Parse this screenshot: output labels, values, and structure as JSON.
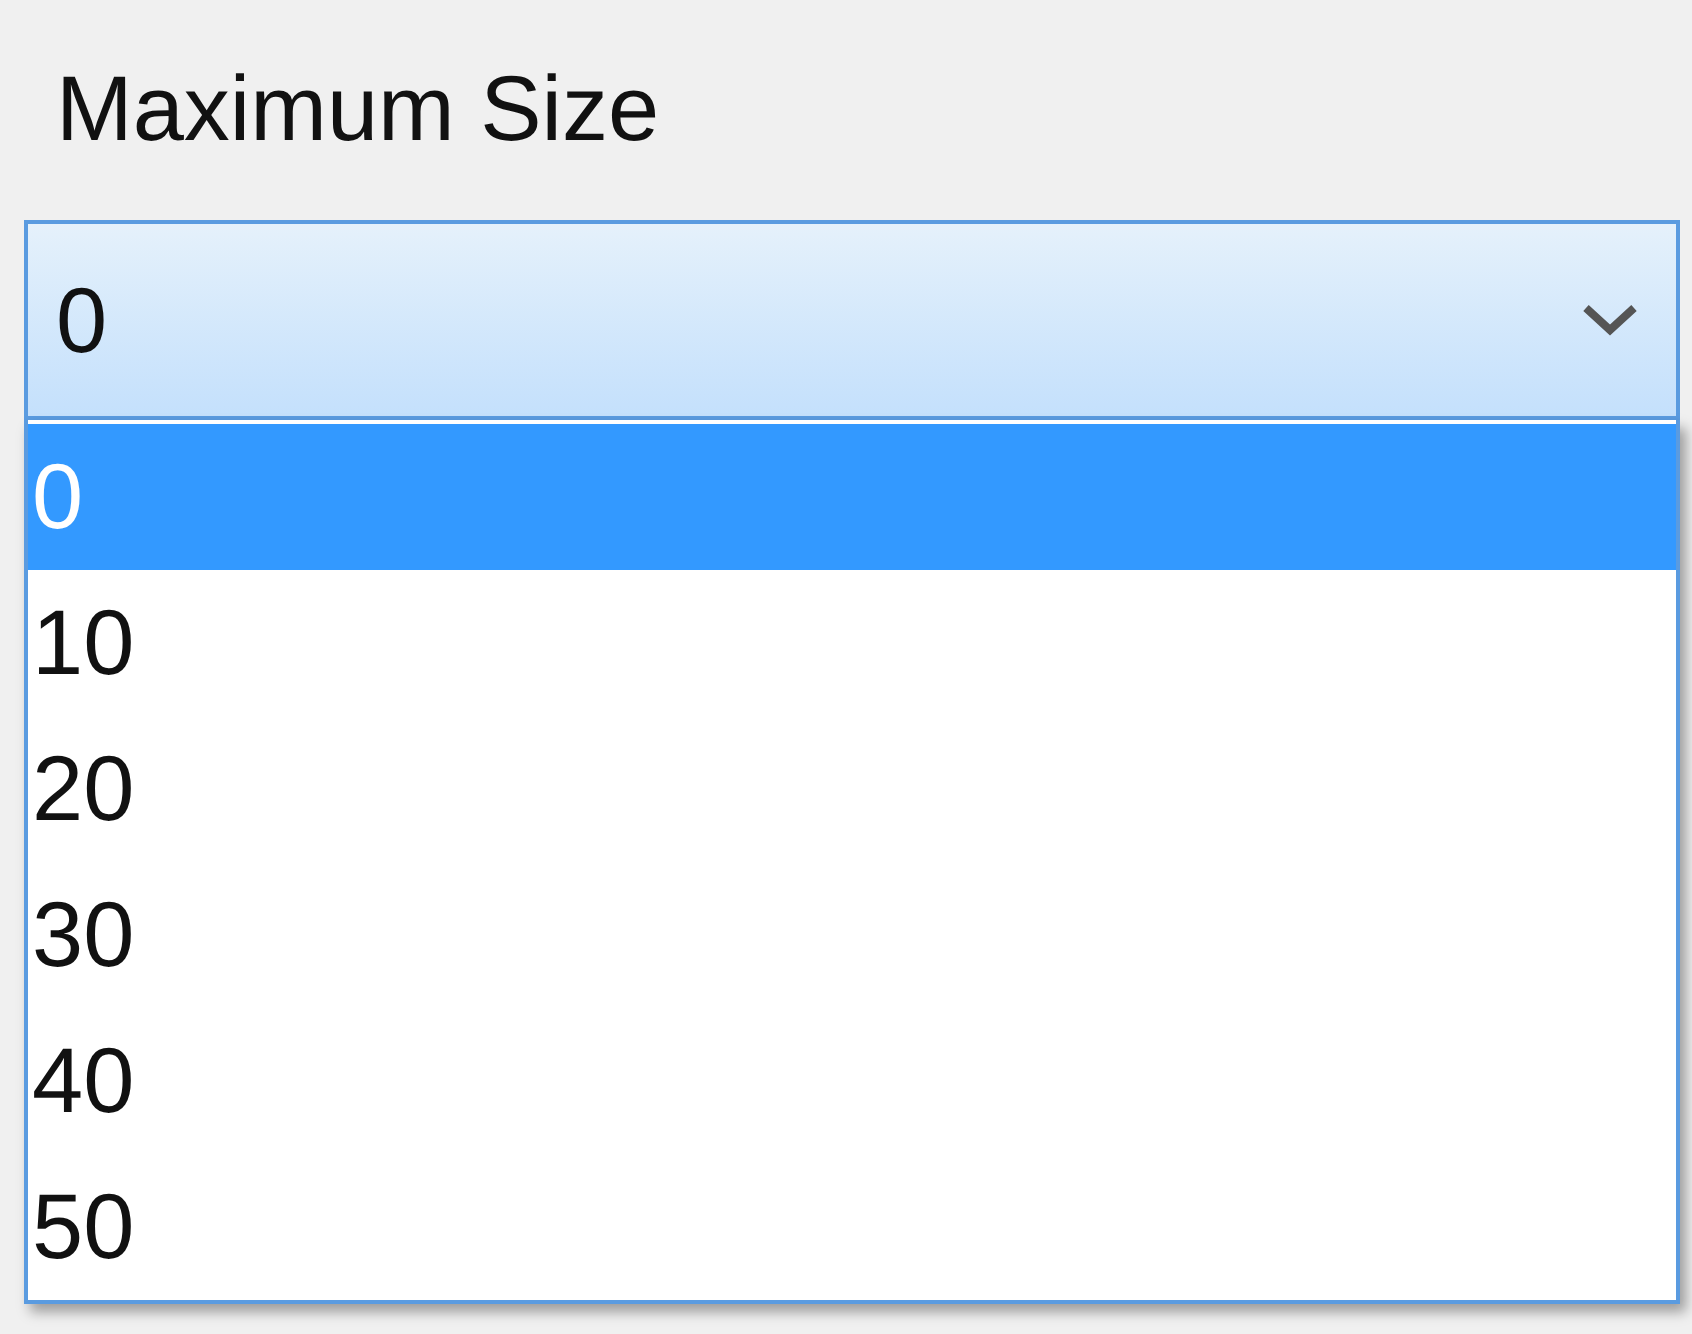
{
  "label": "Maximum Size",
  "combo": {
    "value": "0",
    "expanded": true
  },
  "options": [
    {
      "label": "0",
      "selected": true
    },
    {
      "label": "10",
      "selected": false
    },
    {
      "label": "20",
      "selected": false
    },
    {
      "label": "30",
      "selected": false
    },
    {
      "label": "40",
      "selected": false
    },
    {
      "label": "50",
      "selected": false
    }
  ]
}
